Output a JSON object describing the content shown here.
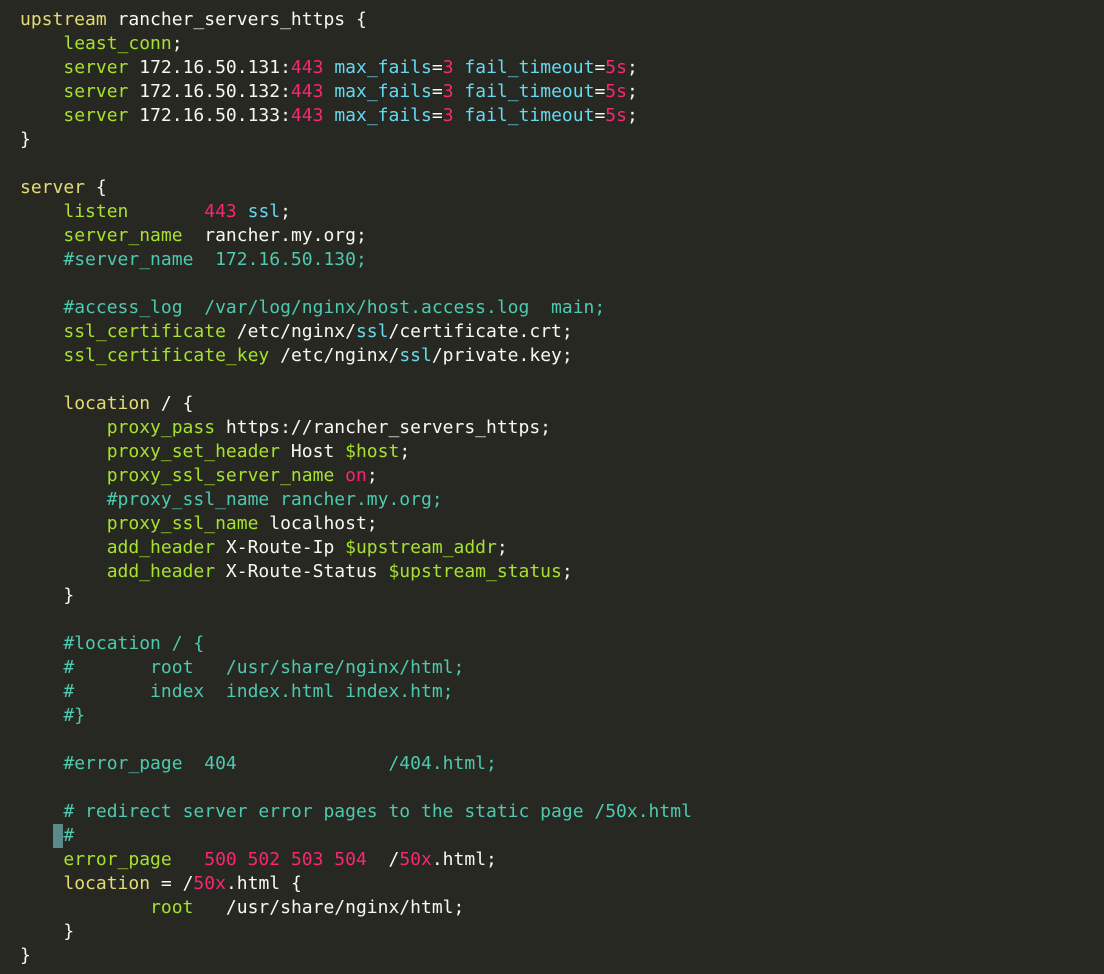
{
  "editor": {
    "theme": {
      "background": "#272822",
      "keyword": "#e6db74",
      "directive": "#a6e22e",
      "number": "#f92672",
      "param": "#66d9ef",
      "comment": "#4ec9b0",
      "text": "#f8f8f2"
    },
    "lines": [
      [
        [
          "kw",
          "upstream"
        ],
        [
          "txt",
          " rancher_servers_https {"
        ]
      ],
      [
        [
          "txt",
          "    "
        ],
        [
          "dir",
          "least_conn"
        ],
        [
          "txt",
          ";"
        ]
      ],
      [
        [
          "txt",
          "    "
        ],
        [
          "dir",
          "server"
        ],
        [
          "txt",
          " 172.16.50.131:"
        ],
        [
          "num",
          "443"
        ],
        [
          "txt",
          " "
        ],
        [
          "prm",
          "max_fails"
        ],
        [
          "txt",
          "="
        ],
        [
          "num",
          "3"
        ],
        [
          "txt",
          " "
        ],
        [
          "prm",
          "fail_timeout"
        ],
        [
          "txt",
          "="
        ],
        [
          "num",
          "5s"
        ],
        [
          "txt",
          ";"
        ]
      ],
      [
        [
          "txt",
          "    "
        ],
        [
          "dir",
          "server"
        ],
        [
          "txt",
          " 172.16.50.132:"
        ],
        [
          "num",
          "443"
        ],
        [
          "txt",
          " "
        ],
        [
          "prm",
          "max_fails"
        ],
        [
          "txt",
          "="
        ],
        [
          "num",
          "3"
        ],
        [
          "txt",
          " "
        ],
        [
          "prm",
          "fail_timeout"
        ],
        [
          "txt",
          "="
        ],
        [
          "num",
          "5s"
        ],
        [
          "txt",
          ";"
        ]
      ],
      [
        [
          "txt",
          "    "
        ],
        [
          "dir",
          "server"
        ],
        [
          "txt",
          " 172.16.50.133:"
        ],
        [
          "num",
          "443"
        ],
        [
          "txt",
          " "
        ],
        [
          "prm",
          "max_fails"
        ],
        [
          "txt",
          "="
        ],
        [
          "num",
          "3"
        ],
        [
          "txt",
          " "
        ],
        [
          "prm",
          "fail_timeout"
        ],
        [
          "txt",
          "="
        ],
        [
          "num",
          "5s"
        ],
        [
          "txt",
          ";"
        ]
      ],
      [
        [
          "txt",
          "}"
        ]
      ],
      [],
      [
        [
          "kw",
          "server"
        ],
        [
          "txt",
          " {"
        ]
      ],
      [
        [
          "txt",
          "    "
        ],
        [
          "dir",
          "listen"
        ],
        [
          "txt",
          "       "
        ],
        [
          "num",
          "443"
        ],
        [
          "txt",
          " "
        ],
        [
          "prm",
          "ssl"
        ],
        [
          "txt",
          ";"
        ]
      ],
      [
        [
          "txt",
          "    "
        ],
        [
          "dir",
          "server_name"
        ],
        [
          "txt",
          "  rancher.my.org;"
        ]
      ],
      [
        [
          "txt",
          "    "
        ],
        [
          "cmt",
          "#server_name  172.16.50.130;"
        ]
      ],
      [],
      [
        [
          "txt",
          "    "
        ],
        [
          "cmt",
          "#access_log  /var/log/nginx/host.access.log  main;"
        ]
      ],
      [
        [
          "txt",
          "    "
        ],
        [
          "dir",
          "ssl_certificate"
        ],
        [
          "txt",
          " /etc/nginx/"
        ],
        [
          "prm",
          "ssl"
        ],
        [
          "txt",
          "/certificate.crt;"
        ]
      ],
      [
        [
          "txt",
          "    "
        ],
        [
          "dir",
          "ssl_certificate_key"
        ],
        [
          "txt",
          " /etc/nginx/"
        ],
        [
          "prm",
          "ssl"
        ],
        [
          "txt",
          "/private.key;"
        ]
      ],
      [],
      [
        [
          "txt",
          "    "
        ],
        [
          "kw",
          "location"
        ],
        [
          "txt",
          " / {"
        ]
      ],
      [
        [
          "txt",
          "        "
        ],
        [
          "dir",
          "proxy_pass"
        ],
        [
          "txt",
          " https://rancher_servers_https;"
        ]
      ],
      [
        [
          "txt",
          "        "
        ],
        [
          "dir",
          "proxy_set_header"
        ],
        [
          "txt",
          " Host "
        ],
        [
          "var",
          "$host"
        ],
        [
          "txt",
          ";"
        ]
      ],
      [
        [
          "txt",
          "        "
        ],
        [
          "dir",
          "proxy_ssl_server_name"
        ],
        [
          "txt",
          " "
        ],
        [
          "num",
          "on"
        ],
        [
          "txt",
          ";"
        ]
      ],
      [
        [
          "txt",
          "        "
        ],
        [
          "cmt",
          "#proxy_ssl_name rancher.my.org;"
        ]
      ],
      [
        [
          "txt",
          "        "
        ],
        [
          "dir",
          "proxy_ssl_name"
        ],
        [
          "txt",
          " localhost;"
        ]
      ],
      [
        [
          "txt",
          "        "
        ],
        [
          "dir",
          "add_header"
        ],
        [
          "txt",
          " X-Route-Ip "
        ],
        [
          "var",
          "$upstream_addr"
        ],
        [
          "txt",
          ";"
        ]
      ],
      [
        [
          "txt",
          "        "
        ],
        [
          "dir",
          "add_header"
        ],
        [
          "txt",
          " X-Route-Status "
        ],
        [
          "var",
          "$upstream_status"
        ],
        [
          "txt",
          ";"
        ]
      ],
      [
        [
          "txt",
          "    }"
        ]
      ],
      [],
      [
        [
          "txt",
          "    "
        ],
        [
          "cmt",
          "#location / {"
        ]
      ],
      [
        [
          "txt",
          "    "
        ],
        [
          "cmt",
          "#       root   /usr/share/nginx/html;"
        ]
      ],
      [
        [
          "txt",
          "    "
        ],
        [
          "cmt",
          "#       index  index.html index.htm;"
        ]
      ],
      [
        [
          "txt",
          "    "
        ],
        [
          "cmt",
          "#}"
        ]
      ],
      [],
      [
        [
          "txt",
          "    "
        ],
        [
          "cmt",
          "#error_page  404              /404.html;"
        ]
      ],
      [],
      [
        [
          "txt",
          "    "
        ],
        [
          "cmt",
          "# redirect server error pages to the static page /50x.html"
        ]
      ],
      [
        [
          "txt",
          "   "
        ],
        [
          "cursor",
          " "
        ],
        [
          "cmt",
          "#"
        ]
      ],
      [
        [
          "txt",
          "    "
        ],
        [
          "dir",
          "error_page"
        ],
        [
          "txt",
          "   "
        ],
        [
          "num",
          "500 502 503 504"
        ],
        [
          "txt",
          "  /"
        ],
        [
          "num",
          "50x"
        ],
        [
          "txt",
          ".html;"
        ]
      ],
      [
        [
          "txt",
          "    "
        ],
        [
          "kw",
          "location"
        ],
        [
          "txt",
          " = /"
        ],
        [
          "num",
          "50x"
        ],
        [
          "txt",
          ".html {"
        ]
      ],
      [
        [
          "txt",
          "            "
        ],
        [
          "dir",
          "root"
        ],
        [
          "txt",
          "   /usr/share/nginx/html;"
        ]
      ],
      [
        [
          "txt",
          "    }"
        ]
      ],
      [
        [
          "txt",
          "}"
        ]
      ]
    ]
  }
}
